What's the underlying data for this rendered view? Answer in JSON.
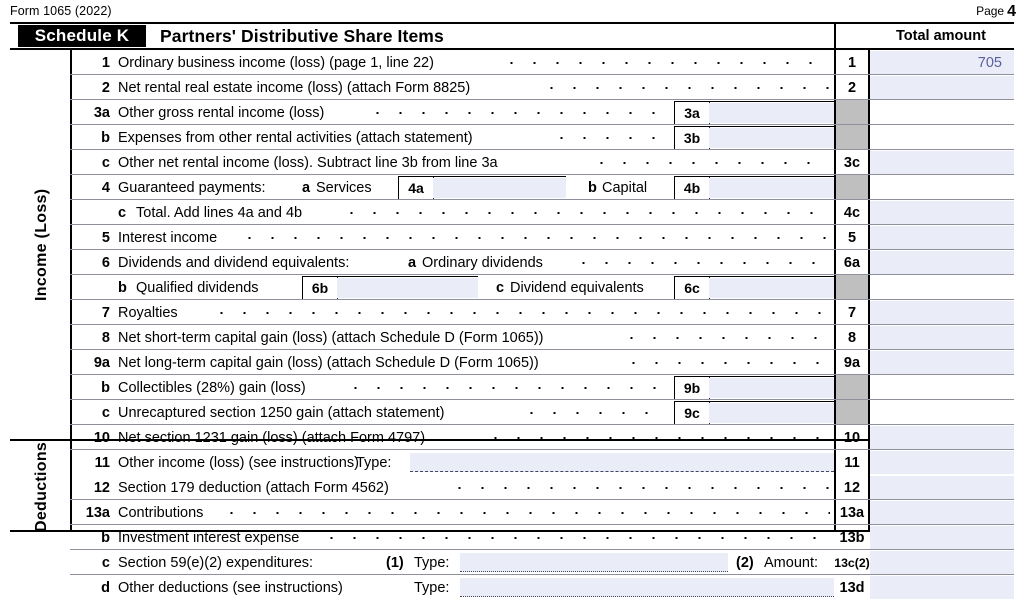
{
  "document": {
    "form_id": "Form 1065 (2022)",
    "page_label": "Page",
    "page_number": "4"
  },
  "header": {
    "schedule_label": "Schedule K",
    "title": "Partners' Distributive Share Items",
    "total_amount_label": "Total amount"
  },
  "sections": [
    {
      "label": "Income (Loss)"
    },
    {
      "label": "Deductions"
    }
  ],
  "colors": {
    "field_fill": "#eaecf8",
    "blocked_cell": "#bfbfbf",
    "value_text": "#5a5f9c",
    "rule": "#000000"
  },
  "rows": [
    {
      "line": "1",
      "desc": "Ordinary business income (loss) (page 1, line 22)",
      "num": "1",
      "value": "705"
    },
    {
      "line": "2",
      "desc": "Net rental real estate income (loss) (attach Form 8825)",
      "num": "2",
      "value": ""
    },
    {
      "line": "3a",
      "desc": "Other gross rental income (loss)",
      "num": "",
      "value": "",
      "subbox": {
        "label": "3a",
        "value": ""
      }
    },
    {
      "line": "b",
      "desc": "Expenses from other rental activities (attach statement)",
      "num": "",
      "value": "",
      "subbox": {
        "label": "3b",
        "value": ""
      }
    },
    {
      "line": "c",
      "desc": "Other net rental income (loss). Subtract line 3b from line 3a",
      "num": "3c",
      "value": ""
    },
    {
      "line": "4",
      "desc": "Guaranteed payments:",
      "desc_a_marker": "a",
      "desc_a_text": "Services",
      "desc_b_marker": "b",
      "desc_b_text": "Capital",
      "num": "",
      "value": "",
      "subbox": {
        "label": "4a",
        "value": ""
      },
      "subbox2": {
        "label": "4b",
        "value": ""
      }
    },
    {
      "line": "",
      "desc_c_marker": "c",
      "desc": "Total. Add lines 4a and 4b",
      "num": "4c",
      "value": ""
    },
    {
      "line": "5",
      "desc": "Interest income",
      "num": "5",
      "value": ""
    },
    {
      "line": "6",
      "desc": "Dividends and dividend equivalents:",
      "desc_a_marker": "a",
      "desc_a_text": "Ordinary dividends",
      "num": "6a",
      "value": ""
    },
    {
      "line": "",
      "desc_b_marker": "b",
      "desc_b_text": "Qualified dividends",
      "desc_c_marker": "c",
      "desc_c_text": "Dividend equivalents",
      "num": "",
      "value": "",
      "subbox": {
        "label": "6b",
        "value": ""
      },
      "subbox2": {
        "label": "6c",
        "value": ""
      }
    },
    {
      "line": "7",
      "desc": "Royalties",
      "num": "7",
      "value": ""
    },
    {
      "line": "8",
      "desc": "Net short-term capital gain (loss) (attach Schedule D (Form 1065))",
      "num": "8",
      "value": ""
    },
    {
      "line": "9a",
      "desc": "Net long-term capital gain (loss) (attach Schedule D (Form 1065))",
      "num": "9a",
      "value": ""
    },
    {
      "line": "b",
      "desc": "Collectibles (28%) gain (loss)",
      "num": "",
      "value": "",
      "subbox": {
        "label": "9b",
        "value": ""
      }
    },
    {
      "line": "c",
      "desc": "Unrecaptured section 1250 gain (attach statement)",
      "num": "",
      "value": "",
      "subbox": {
        "label": "9c",
        "value": ""
      }
    },
    {
      "line": "10",
      "desc": "Net section 1231 gain (loss) (attach Form 4797)",
      "num": "10",
      "value": ""
    },
    {
      "line": "11",
      "desc": "Other income (loss) (see instructions)",
      "type_label": "Type:",
      "type_value": "",
      "num": "11",
      "value": ""
    },
    {
      "line": "12",
      "desc": "Section 179 deduction (attach Form 4562)",
      "num": "12",
      "value": ""
    },
    {
      "line": "13a",
      "desc": "Contributions",
      "num": "13a",
      "value": ""
    },
    {
      "line": "b",
      "desc": "Investment interest expense",
      "num": "13b",
      "value": ""
    },
    {
      "line": "c",
      "desc": "Section 59(e)(2) expenditures:",
      "sub1_marker": "(1)",
      "type_label": "Type:",
      "type_value": "",
      "sub2_marker": "(2)",
      "amount_label": "Amount:",
      "num": "13c(2)",
      "value": ""
    },
    {
      "line": "d",
      "desc": "Other deductions (see instructions)",
      "type_label": "Type:",
      "type_value": "",
      "num": "13d",
      "value": ""
    }
  ]
}
